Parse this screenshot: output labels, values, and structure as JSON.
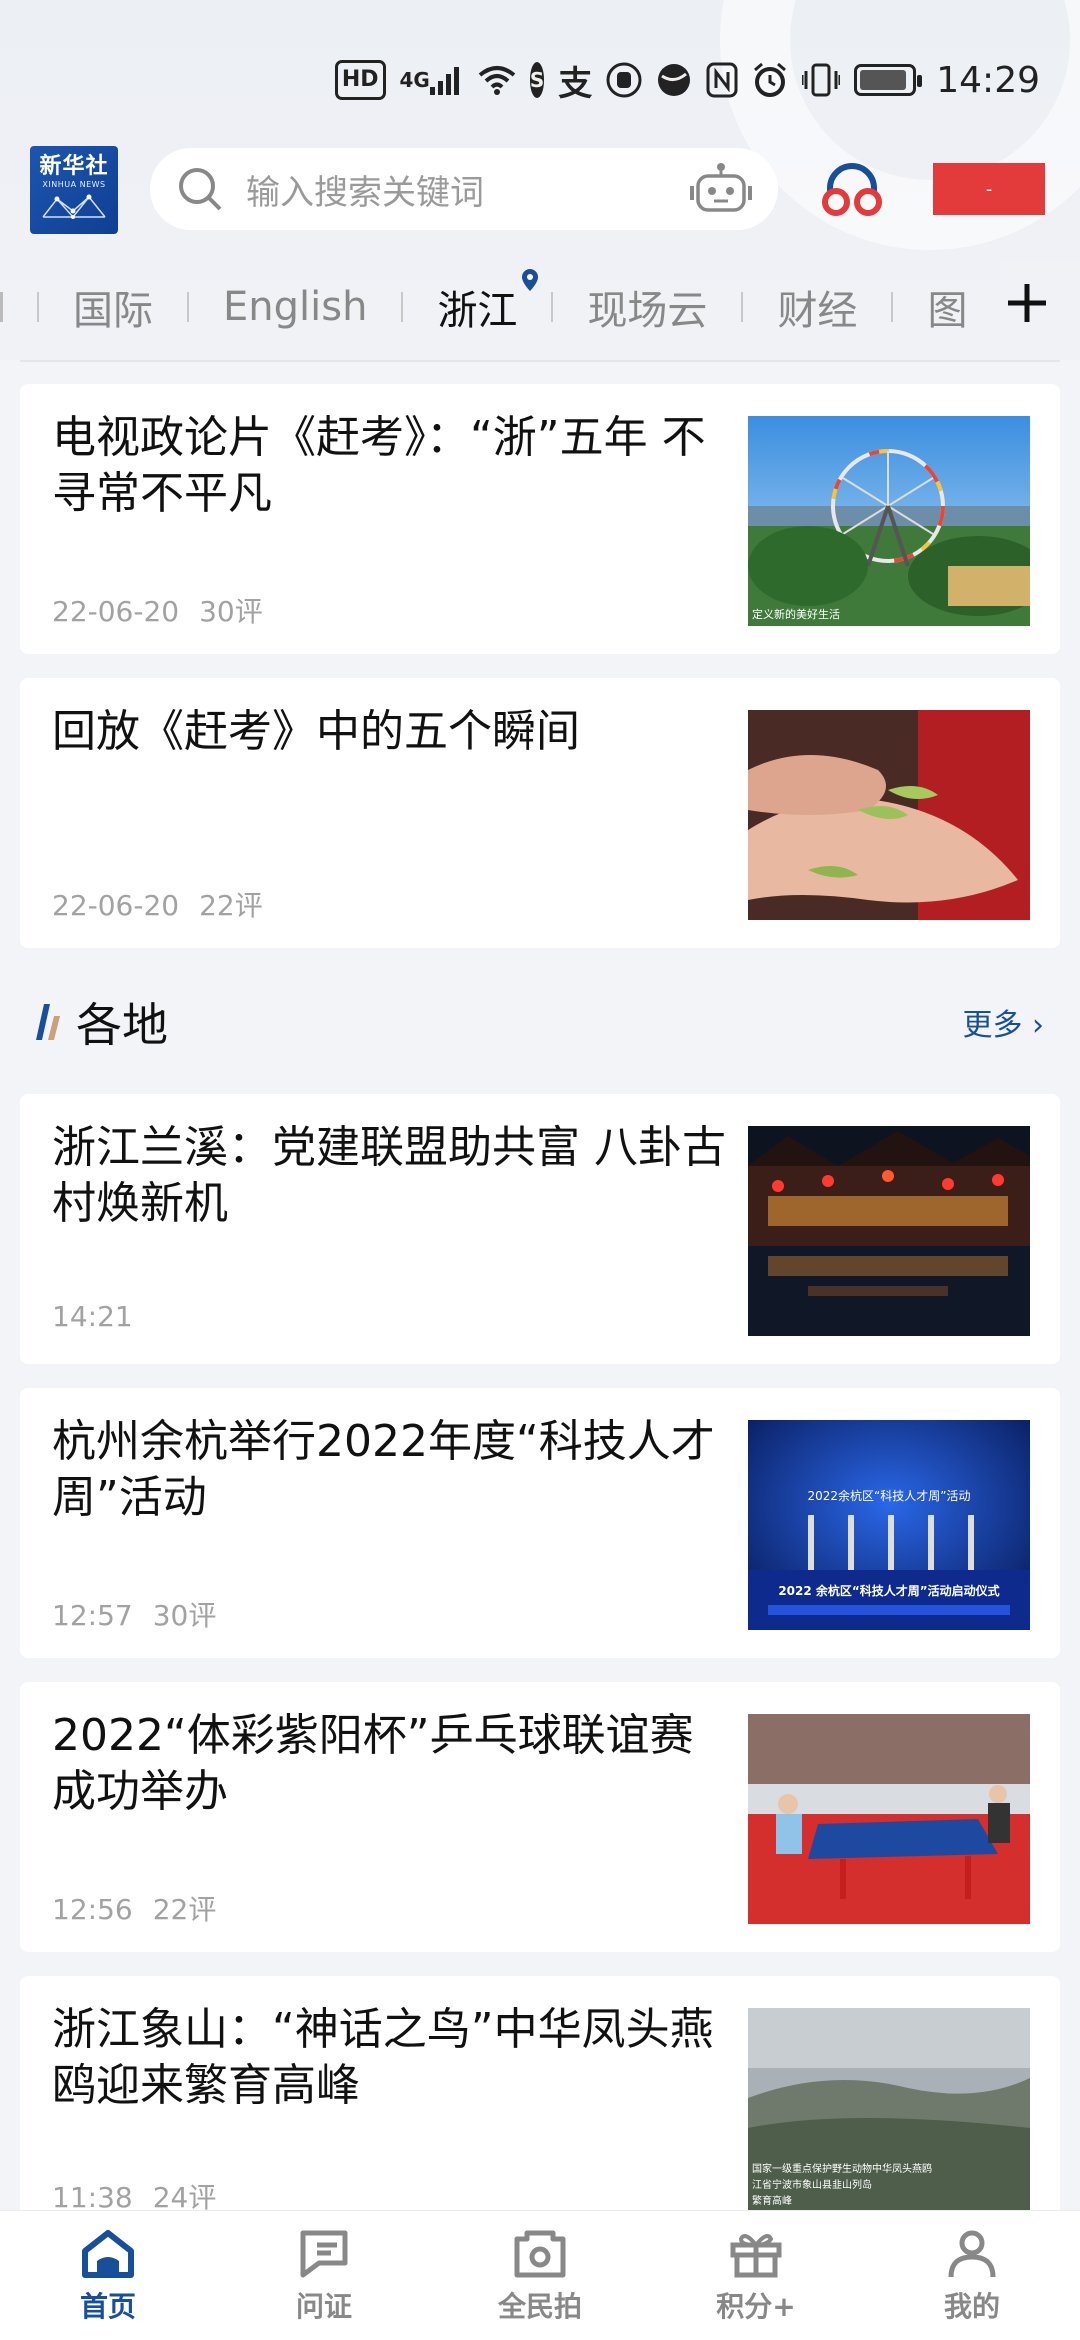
{
  "status_bar": {
    "hd": "HD",
    "network": "4G",
    "time": "14:29",
    "icons": [
      "hd-icon",
      "signal-icon",
      "wifi-icon",
      "weibo-icon",
      "alipay-icon",
      "hand-icon",
      "globe-icon",
      "nfc-icon",
      "alarm-icon",
      "vibrate-icon",
      "battery-icon"
    ]
  },
  "header": {
    "logo_cn": "新华社",
    "logo_en": "XINHUA NEWS",
    "search_placeholder": "输入搜索关键词",
    "red_button_label": "-"
  },
  "tabs": {
    "items": [
      {
        "label": "国际"
      },
      {
        "label": "English"
      },
      {
        "label": "浙江",
        "active": true
      },
      {
        "label": "现场云"
      },
      {
        "label": "财经"
      },
      {
        "label": "图"
      }
    ]
  },
  "feed": {
    "top_cards": [
      {
        "title": "电视政论片《赶考》：“浙”五年 不寻常不平凡",
        "date": "22-06-20",
        "comments": "30评",
        "image_caption": "定义新的美好生活"
      },
      {
        "title": "回放《赶考》中的五个瞬间",
        "date": "22-06-20",
        "comments": "22评"
      }
    ],
    "section": {
      "title": "各地",
      "more": "更多 ›"
    },
    "local_cards": [
      {
        "title": "浙江兰溪：党建联盟助共富 八卦古村焕新机",
        "date": "14:21",
        "comments": ""
      },
      {
        "title": "杭州余杭举行2022年度“科技人才周”活动",
        "date": "12:57",
        "comments": "30评",
        "image_caption_1": "2022余杭区“科技人才周”活动",
        "image_caption_2": "2022 余杭区“科技人才周”活动启动仪式"
      },
      {
        "title": "2022“体彩紫阳杯”乒乓球联谊赛成功举办",
        "date": "12:56",
        "comments": "22评"
      },
      {
        "title": "浙江象山：“神话之鸟”中华凤头燕鸥迎来繁育高峰",
        "date": "11:38",
        "comments": "24评",
        "image_caption_1": "国家一级重点保护野生动物中华凤头燕鸥",
        "image_caption_2": "江省宁波市象山县韭山列岛",
        "image_caption_3": "繁育高峰"
      }
    ]
  },
  "bottom_nav": {
    "items": [
      {
        "label": "首页",
        "icon": "home-icon",
        "active": true
      },
      {
        "label": "问证",
        "icon": "flag-icon"
      },
      {
        "label": "全民拍",
        "icon": "camera-icon"
      },
      {
        "label": "积分+",
        "icon": "gift-icon"
      },
      {
        "label": "我的",
        "icon": "profile-icon"
      }
    ]
  },
  "colors": {
    "accent": "#184f9a",
    "red": "#e33b3b",
    "background": "#f3f4f7"
  }
}
